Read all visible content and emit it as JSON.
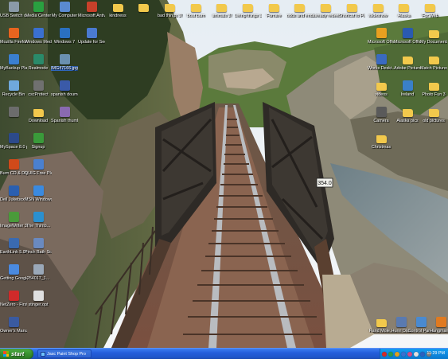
{
  "desktop": {
    "left_icons": [
      {
        "label": "USB Switch control",
        "icon": "usb-switch-icon",
        "color": "#8a9aa8"
      },
      {
        "label": "Mozilla Firefox",
        "icon": "firefox-icon",
        "color": "#e8641f"
      },
      {
        "label": "MyBackup Player",
        "icon": "mybackup-icon",
        "color": "#3a7fd0"
      },
      {
        "label": "Recycle Bin",
        "icon": "recycle-bin-icon",
        "color": "#6fa8dc"
      },
      {
        "label": "",
        "icon": "blank-icon",
        "color": "#6c6c6c"
      },
      {
        "label": "MySpace 8.0 pleased",
        "icon": "myspace-icon",
        "color": "#2c4a8a"
      },
      {
        "label": "Burn CD & DVDs with",
        "icon": "burn-cd-icon",
        "color": "#d04a1a"
      },
      {
        "label": "Dell Jukebox by musicmatch",
        "icon": "dell-jukebox-icon",
        "color": "#2a5fb0"
      },
      {
        "label": "ImageWriter 3.01",
        "icon": "imagewriter-icon",
        "color": "#4a9a3a"
      },
      {
        "label": "EarthLink 5.0 Places list",
        "icon": "earthlink-icon",
        "color": "#3a6ab0"
      },
      {
        "label": "Getting Google...",
        "icon": "google-icon",
        "color": "#4a8ae0"
      },
      {
        "label": "NetZero - First Month Free",
        "icon": "netzero-icon",
        "color": "#d02a2a"
      },
      {
        "label": "Owner's Manual",
        "icon": "manual-icon",
        "color": "#3a5aa0"
      }
    ],
    "col2_icons": [
      {
        "label": "Media Center",
        "icon": "media-center-icon",
        "color": "#2aa040"
      },
      {
        "label": "Windows Media Player",
        "icon": "media-player-icon",
        "color": "#3a70d0"
      },
      {
        "label": "Realmode",
        "icon": "realmode-icon",
        "color": "#2a8a6a"
      },
      {
        "label": "cscProtect",
        "icon": "csc-protect-icon",
        "color": "#707070"
      },
      {
        "label": "Download",
        "icon": "download-folder-icon",
        "color": "#f2c94c",
        "folder": true
      },
      {
        "label": "Signup",
        "icon": "signup-icon",
        "color": "#3a9a3a"
      },
      {
        "label": "QUIG Free Player",
        "icon": "quig-player-icon",
        "color": "#4a80d0"
      },
      {
        "label": "MSN Windows...",
        "icon": "msn-icon",
        "color": "#3a8ae0"
      },
      {
        "label": "The Thimb...",
        "icon": "thimb-icon",
        "color": "#2a90d0"
      },
      {
        "label": "Pinch Bath Scooter V...",
        "icon": "pinch-bath-icon",
        "color": "#6a8ac0"
      },
      {
        "label": "254017_1...",
        "icon": "file-icon",
        "color": "#9aa8b8"
      },
      {
        "label": "stinger.opt",
        "icon": "stinger-icon",
        "color": "#e0e0e0"
      }
    ],
    "col3_icons": [
      {
        "label": "My Computer",
        "icon": "my-computer-icon",
        "color": "#5a8ad0"
      },
      {
        "label": "Windows 7",
        "icon": "windows-icon",
        "color": "#2a70c0"
      },
      {
        "label": "IMG47166.jpg",
        "icon": "image-file-icon",
        "color": "#6a90b0",
        "selected": true
      },
      {
        "label": "spanish doumend",
        "icon": "word-doc-icon",
        "color": "#3a5aa8"
      },
      {
        "label": "Spanish thumbed.gif",
        "icon": "gif-file-icon",
        "color": "#8a6ab0"
      }
    ],
    "col4_icons": [
      {
        "label": "Microsoft Antivirus Sc",
        "icon": "antivirus-icon",
        "color": "#c8402a"
      },
      {
        "label": "Update for Secr...",
        "icon": "update-icon",
        "color": "#4a7ad0"
      }
    ],
    "top_icons": [
      {
        "label": "kindness",
        "icon": "folder-icon",
        "color": "#f2c94c",
        "folder": true
      },
      {
        "label": "",
        "icon": "folder-icon",
        "color": "#f2c94c",
        "folder": true
      },
      {
        "label": "bad things 3!",
        "icon": "folder-icon",
        "color": "#f2c94c",
        "folder": true
      },
      {
        "label": "bout burn",
        "icon": "folder-icon",
        "color": "#f2c94c",
        "folder": true
      },
      {
        "label": "animals 3!",
        "icon": "folder-icon",
        "color": "#f2c94c",
        "folder": true
      },
      {
        "label": "Living things 3!!",
        "icon": "folder-icon",
        "color": "#f2c94c",
        "folder": true
      },
      {
        "label": "Fumare",
        "icon": "folder-icon",
        "color": "#f2c94c",
        "folder": true
      },
      {
        "label": "odds and ends",
        "icon": "folder-icon",
        "color": "#f2c94c",
        "folder": true
      },
      {
        "label": "already redeed",
        "icon": "folder-icon",
        "color": "#f2c94c",
        "folder": true
      },
      {
        "label": "Shortcut to Pictures",
        "icon": "pictures-shortcut-icon",
        "color": "#f2c94c",
        "folder": true
      },
      {
        "label": "slideshow",
        "icon": "folder-icon",
        "color": "#f2c94c",
        "folder": true
      },
      {
        "label": "Alaska",
        "icon": "folder-icon",
        "color": "#f2c94c",
        "folder": true
      },
      {
        "label": "For Web",
        "icon": "folder-icon",
        "color": "#f2c94c",
        "folder": true
      }
    ],
    "right_icons": [
      {
        "label": "Microsoft Office Outl...",
        "icon": "outlook-icon",
        "color": "#e8a020"
      },
      {
        "label": "Microsoft Office W...",
        "icon": "word-icon",
        "color": "#2a5ab0"
      },
      {
        "label": "My Documents",
        "icon": "my-documents-icon",
        "color": "#f2c94c",
        "folder": true
      },
      {
        "label": "Works Deskt... Clean Desk",
        "icon": "works-icon",
        "color": "#3a6ac0"
      },
      {
        "label": "Adobe Pictures Flow panels",
        "icon": "folder-icon",
        "color": "#f2c94c",
        "folder": true
      },
      {
        "label": "Match Pictures",
        "icon": "folder-icon",
        "color": "#f2c94c",
        "folder": true
      },
      {
        "label": "videos",
        "icon": "folder-icon",
        "color": "#f2c94c",
        "folder": true
      },
      {
        "label": "Ireland",
        "icon": "ireland-icon",
        "color": "#3a80c8"
      },
      {
        "label": "Photo Fun 3",
        "icon": "folder-icon",
        "color": "#f2c94c",
        "folder": true
      },
      {
        "label": "Camera",
        "icon": "camera-icon",
        "color": "#5a5a5a"
      },
      {
        "label": "Alaska pics",
        "icon": "folder-icon",
        "color": "#f2c94c",
        "folder": true
      },
      {
        "label": "old pictures",
        "icon": "folder-icon",
        "color": "#f2c94c",
        "folder": true
      },
      {
        "label": "Christmas",
        "icon": "folder-icon",
        "color": "#f2c94c",
        "folder": true
      }
    ],
    "bottom_right_icons": [
      {
        "label": "Rand Mole...",
        "icon": "folder-icon",
        "color": "#f2c94c",
        "folder": true
      },
      {
        "label": "Hunn Disk",
        "icon": "disk-icon",
        "color": "#5a7ab0"
      },
      {
        "label": "Control Panel",
        "icon": "control-panel-icon",
        "color": "#4a8ad0"
      },
      {
        "label": "Hangman...",
        "icon": "hangman-icon",
        "color": "#e07a20"
      }
    ]
  },
  "wallpaper": {
    "bridge_sign": "354.0"
  },
  "taskbar": {
    "start_label": "start",
    "active_task": "Jasc Paint Shop Pro",
    "clock": "11:29 PM",
    "tray_colors": [
      "#d02a2a",
      "#2a9a4a",
      "#e0a020",
      "#3a70d0",
      "#d04a8a",
      "#e0e0e0",
      "#2a60c0",
      "#7a7a7a"
    ]
  }
}
